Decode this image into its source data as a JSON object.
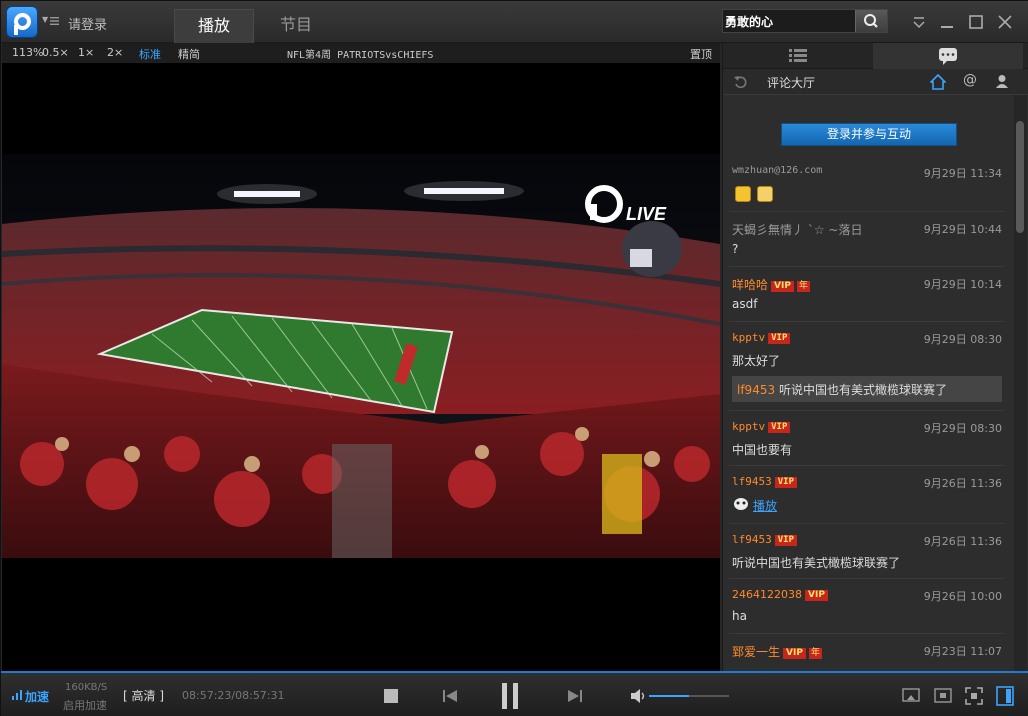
{
  "titlebar": {
    "login": "请登录",
    "tabs": [
      {
        "label": "播放",
        "active": true
      },
      {
        "label": "节目",
        "active": false
      }
    ],
    "search_value": "勇敢的心"
  },
  "infobar": {
    "zoom": "113%",
    "speeds": [
      "0.5×",
      "1×",
      "2×"
    ],
    "quality_standard": "标准",
    "quality_simple": "精简",
    "program_title": "NFL第4周 PATRIOTSvsCHIEFS",
    "pin_top": "置顶"
  },
  "video": {
    "live_badge": "LIVE"
  },
  "panel": {
    "header_title": "评论大厅",
    "cta_label": "登录并参与互动",
    "messages": [
      {
        "user": "wmzhuan@126.com",
        "user_style": "gray",
        "time": "9月29日 11:34",
        "text": "",
        "emoji": true
      },
      {
        "user": "天蝎彡無情丿 ˋ☆ ~落日",
        "user_style": "gray",
        "time": "9月29日 10:44",
        "text": "?"
      },
      {
        "user": "咩哈哈",
        "user_style": "orange",
        "vip": "VIP",
        "nian": "年",
        "time": "9月29日 10:14",
        "text": "asdf"
      },
      {
        "user": "kpptv",
        "user_style": "orange",
        "vip": "VIP",
        "time": "9月29日 08:30",
        "text": "那太好了",
        "quote_name": "lf9453",
        "quote_text": "听说中国也有美式橄榄球联赛了"
      },
      {
        "user": "kpptv",
        "user_style": "orange",
        "vip": "VIP",
        "time": "9月29日 08:30",
        "text": "中国也要有"
      },
      {
        "user": "lf9453",
        "user_style": "orange",
        "vip": "VIP",
        "time": "9月26日 11:36",
        "text": "播放",
        "link": true
      },
      {
        "user": "lf9453",
        "user_style": "orange",
        "vip": "VIP",
        "time": "9月26日 11:36",
        "text": "听说中国也有美式橄榄球联赛了"
      },
      {
        "user": "2464122038",
        "user_style": "orange",
        "vip": "VIP",
        "time": "9月26日 10:00",
        "text": "ha"
      },
      {
        "user": "郅爱一生",
        "user_style": "orange",
        "vip": "VIP",
        "nian": "年",
        "time": "9月23日 11:07",
        "text": ""
      }
    ]
  },
  "controls": {
    "accelerate": "加速",
    "rate": "160KB/S",
    "enable_accel": "启用加速",
    "quality": "高清",
    "time": "08:57:23/08:57:31",
    "volume_fraction": 0.5
  },
  "colors": {
    "accent": "#3ba4ff",
    "username_orange": "#ff8a2a",
    "vip_red": "#c7261c"
  }
}
